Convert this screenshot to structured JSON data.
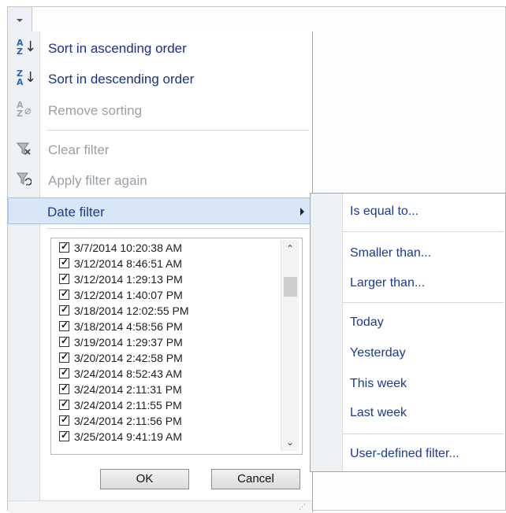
{
  "menu": {
    "items": [
      {
        "label": "Sort in ascending order",
        "enabled": true,
        "icon": "sort-ascending-icon"
      },
      {
        "label": "Sort in descending order",
        "enabled": true,
        "icon": "sort-descending-icon"
      },
      {
        "label": "Remove sorting",
        "enabled": false,
        "icon": "remove-sorting-icon"
      },
      {
        "label": "Clear filter",
        "enabled": false,
        "icon": "clear-filter-icon"
      },
      {
        "label": "Apply filter again",
        "enabled": false,
        "icon": "reapply-filter-icon"
      },
      {
        "label": "Date filter",
        "enabled": true,
        "highlighted": true,
        "icon": "submenu-arrow-icon"
      }
    ]
  },
  "list": {
    "items": [
      {
        "label": "3/7/2014 10:20:38 AM",
        "checked": true
      },
      {
        "label": "3/12/2014 8:46:51 AM",
        "checked": true
      },
      {
        "label": "3/12/2014 1:29:13 PM",
        "checked": true
      },
      {
        "label": "3/12/2014 1:40:07 PM",
        "checked": true
      },
      {
        "label": "3/18/2014 12:02:55 PM",
        "checked": true
      },
      {
        "label": "3/18/2014 4:58:56 PM",
        "checked": true
      },
      {
        "label": "3/19/2014 1:29:37 PM",
        "checked": true
      },
      {
        "label": "3/20/2014 2:42:58 PM",
        "checked": true
      },
      {
        "label": "3/24/2014 8:52:43 AM",
        "checked": true
      },
      {
        "label": "3/24/2014 2:11:31 PM",
        "checked": true
      },
      {
        "label": "3/24/2014 2:11:55 PM",
        "checked": true
      },
      {
        "label": "3/24/2014 2:11:56 PM",
        "checked": true
      },
      {
        "label": "3/25/2014 9:41:19 AM",
        "checked": true
      }
    ]
  },
  "buttons": {
    "ok": "OK",
    "cancel": "Cancel"
  },
  "submenu": {
    "items": [
      "Is equal to...",
      "Smaller than...",
      "Larger than...",
      "Today",
      "Yesterday",
      "This week",
      "Last week",
      "User-defined filter..."
    ]
  },
  "colors": {
    "enabled_text": "#1a2f8a",
    "disabled_text": "#9aa0a6",
    "highlight_bg": "#d8e7f8",
    "highlight_border": "#a2c2ea",
    "submenu_text": "#1c3b91"
  }
}
